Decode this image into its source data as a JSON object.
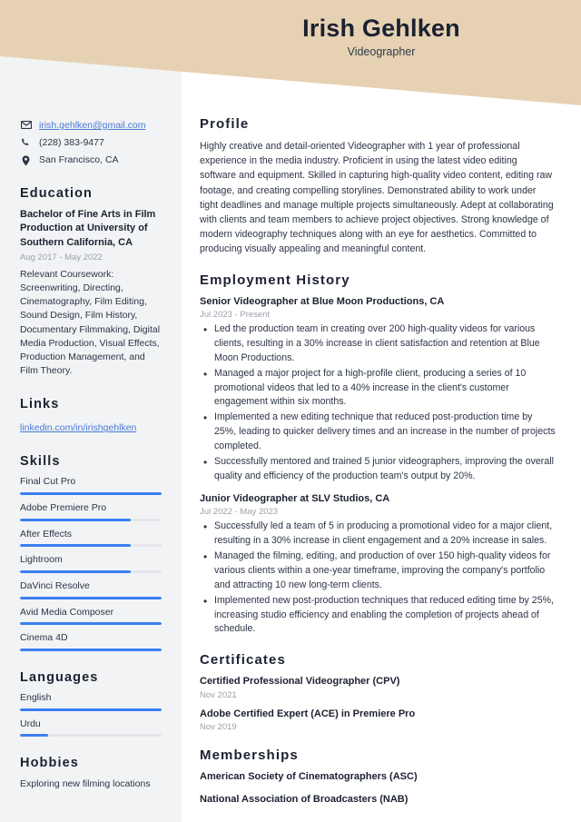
{
  "theme": {
    "banner_color": "#e6d2b3",
    "sidebar_color": "#f2f3f5",
    "accent_color": "#3b7ff0",
    "link_color": "#4a79d4",
    "text_color": "#2b3446",
    "muted_color": "#9aa0ab"
  },
  "header": {
    "name": "Irish Gehlken",
    "job_title": "Videographer"
  },
  "contact": {
    "email": "irish.gehlken@gmail.com",
    "phone": "(228) 383-9477",
    "location": "San Francisco, CA"
  },
  "education": {
    "heading": "Education",
    "entries": [
      {
        "degree": "Bachelor of Fine Arts in Film Production at University of Southern California, CA",
        "dates": "Aug 2017 - May 2022",
        "description": "Relevant Coursework: Screenwriting, Directing, Cinematography, Film Editing, Sound Design, Film History, Documentary Filmmaking, Digital Media Production, Visual Effects, Production Management, and Film Theory."
      }
    ]
  },
  "links": {
    "heading": "Links",
    "items": [
      {
        "label": "linkedin.com/in/irishgehlken"
      }
    ]
  },
  "skills": {
    "heading": "Skills",
    "items": [
      {
        "label": "Final Cut Pro",
        "level": 100
      },
      {
        "label": "Adobe Premiere Pro",
        "level": 78
      },
      {
        "label": "After Effects",
        "level": 78
      },
      {
        "label": "Lightroom",
        "level": 78
      },
      {
        "label": "DaVinci Resolve",
        "level": 100
      },
      {
        "label": "Avid Media Composer",
        "level": 100
      },
      {
        "label": "Cinema 4D",
        "level": 100
      }
    ]
  },
  "languages": {
    "heading": "Languages",
    "items": [
      {
        "label": "English",
        "level": 100
      },
      {
        "label": "Urdu",
        "level": 20
      }
    ]
  },
  "hobbies": {
    "heading": "Hobbies",
    "items": [
      {
        "label": "Exploring new filming locations"
      }
    ]
  },
  "profile": {
    "heading": "Profile",
    "text": "Highly creative and detail-oriented Videographer with 1 year of professional experience in the media industry. Proficient in using the latest video editing software and equipment. Skilled in capturing high-quality video content, editing raw footage, and creating compelling storylines. Demonstrated ability to work under tight deadlines and manage multiple projects simultaneously. Adept at collaborating with clients and team members to achieve project objectives. Strong knowledge of modern videography techniques along with an eye for aesthetics. Committed to producing visually appealing and meaningful content."
  },
  "employment": {
    "heading": "Employment History",
    "jobs": [
      {
        "title": "Senior Videographer at Blue Moon Productions, CA",
        "dates": "Jul 2023 - Present",
        "bullets": [
          "Led the production team in creating over 200 high-quality videos for various clients, resulting in a 30% increase in client satisfaction and retention at Blue Moon Productions.",
          "Managed a major project for a high-profile client, producing a series of 10 promotional videos that led to a 40% increase in the client's customer engagement within six months.",
          "Implemented a new editing technique that reduced post-production time by 25%, leading to quicker delivery times and an increase in the number of projects completed.",
          "Successfully mentored and trained 5 junior videographers, improving the overall quality and efficiency of the production team's output by 20%."
        ]
      },
      {
        "title": "Junior Videographer at SLV Studios, CA",
        "dates": "Jul 2022 - May 2023",
        "bullets": [
          "Successfully led a team of 5 in producing a promotional video for a major client, resulting in a 30% increase in client engagement and a 20% increase in sales.",
          "Managed the filming, editing, and production of over 150 high-quality videos for various clients within a one-year timeframe, improving the company's portfolio and attracting 10 new long-term clients.",
          "Implemented new post-production techniques that reduced editing time by 25%, increasing studio efficiency and enabling the completion of projects ahead of schedule."
        ]
      }
    ]
  },
  "certificates": {
    "heading": "Certificates",
    "items": [
      {
        "title": "Certified Professional Videographer (CPV)",
        "date": "Nov 2021"
      },
      {
        "title": "Adobe Certified Expert (ACE) in Premiere Pro",
        "date": "Nov 2019"
      }
    ]
  },
  "memberships": {
    "heading": "Memberships",
    "items": [
      {
        "title": "American Society of Cinematographers (ASC)"
      },
      {
        "title": "National Association of Broadcasters (NAB)"
      }
    ]
  }
}
